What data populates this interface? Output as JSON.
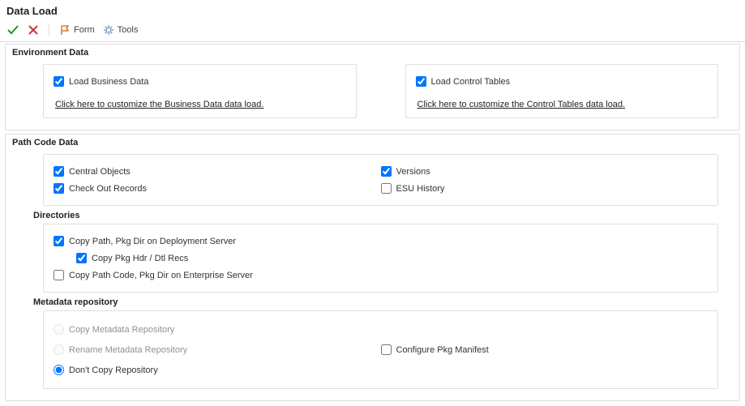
{
  "page": {
    "title": "Data Load"
  },
  "toolbar": {
    "ok_label": "",
    "cancel_label": "",
    "form_label": "Form",
    "tools_label": "Tools"
  },
  "environment": {
    "section_title": "Environment Data",
    "load_business_data": {
      "label": "Load Business Data",
      "checked": true
    },
    "business_link": "Click here to customize the Business Data data load.",
    "load_control_tables": {
      "label": "Load Control Tables",
      "checked": true
    },
    "control_link": "Click here to customize the Control Tables data load."
  },
  "pathcode": {
    "section_title": "Path Code Data",
    "central_objects": {
      "label": "Central Objects",
      "checked": true
    },
    "check_out_records": {
      "label": "Check Out Records",
      "checked": true
    },
    "versions": {
      "label": "Versions",
      "checked": true
    },
    "esu_history": {
      "label": "ESU History",
      "checked": false
    },
    "directories": {
      "title": "Directories",
      "copy_path_pkg_deploy": {
        "label": "Copy Path, Pkg Dir on Deployment Server",
        "checked": true
      },
      "copy_pkg_hdr_dtl": {
        "label": "Copy Pkg Hdr / Dtl Recs",
        "checked": true
      },
      "copy_pathcode_pkg_enterprise": {
        "label": "Copy Path Code, Pkg Dir on Enterprise Server",
        "checked": false
      }
    },
    "metadata": {
      "title": "Metadata repository",
      "copy_repo": "Copy Metadata Repository",
      "rename_repo": "Rename Metadata Repository",
      "dont_copy_repo": "Don't Copy Repository",
      "selected": "dont_copy_repo",
      "configure_pkg_manifest": {
        "label": "Configure Pkg Manifest",
        "checked": false
      }
    }
  }
}
